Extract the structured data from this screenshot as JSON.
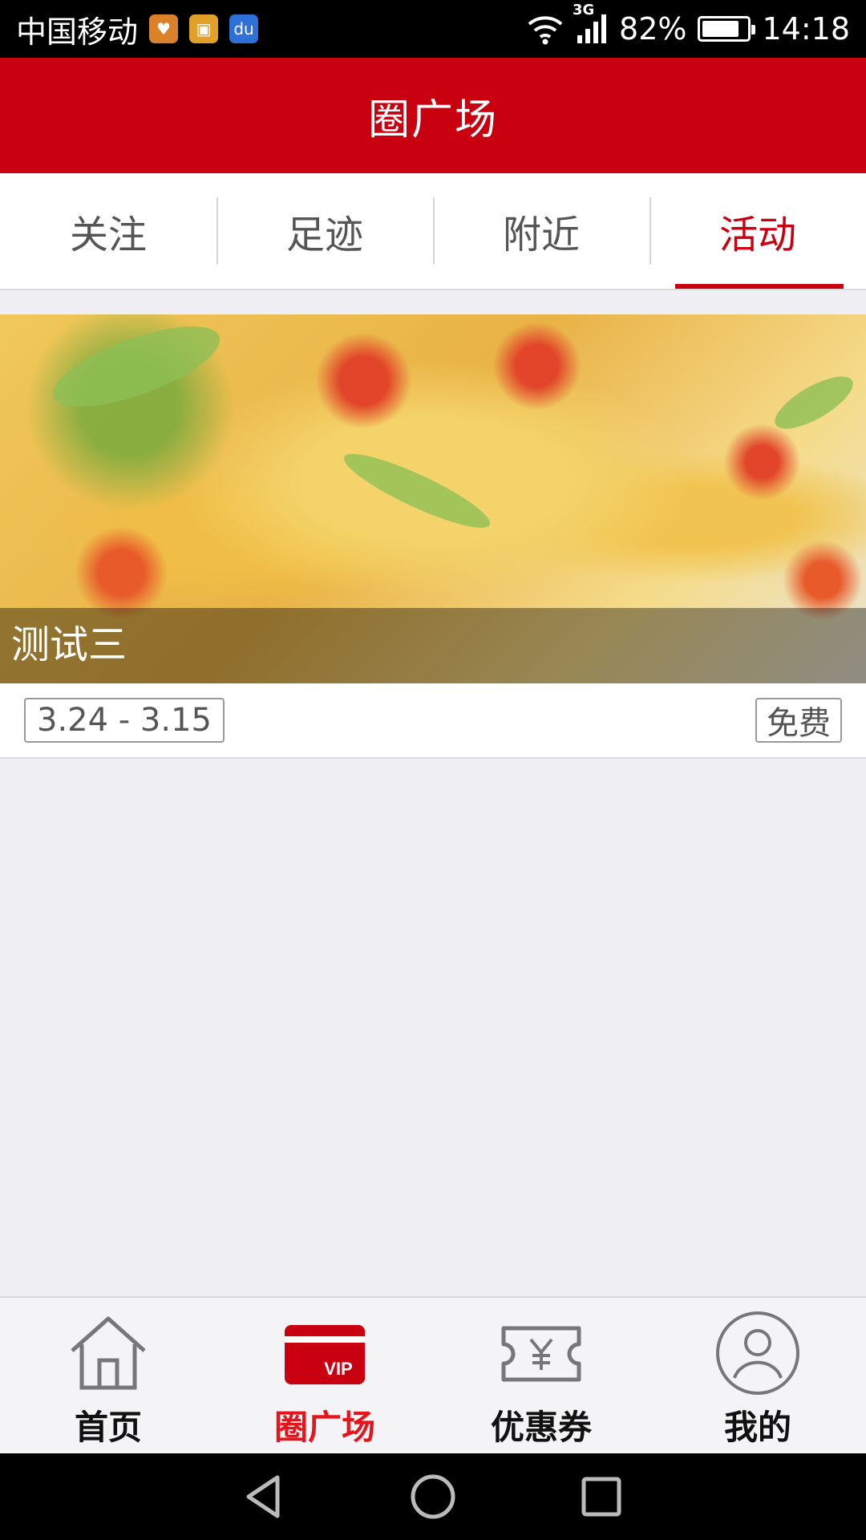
{
  "status_bar": {
    "carrier": "中国移动",
    "network": "3G",
    "battery": "82%",
    "battery_level": 0.82,
    "time": "14:18",
    "app_icons": [
      "health-app-icon",
      "shopping-app-icon",
      "baidu-app-icon"
    ]
  },
  "header": {
    "title": "圈广场"
  },
  "tabs": [
    {
      "label": "关注",
      "active": false
    },
    {
      "label": "足迹",
      "active": false
    },
    {
      "label": "附近",
      "active": false
    },
    {
      "label": "活动",
      "active": true
    }
  ],
  "activity": {
    "title": "测试三",
    "date_range": "3.24 - 3.15",
    "price": "免费"
  },
  "bottom_nav": [
    {
      "label": "首页",
      "icon": "home-icon",
      "active": false
    },
    {
      "label": "圈广场",
      "icon": "vip-card-icon",
      "active": true
    },
    {
      "label": "优惠券",
      "icon": "coupon-icon",
      "active": false
    },
    {
      "label": "我的",
      "icon": "profile-icon",
      "active": false
    }
  ],
  "system_nav": [
    "back-icon",
    "home-circle-icon",
    "recents-icon"
  ],
  "colors": {
    "brand_red": "#c8000f",
    "active_nav_red": "#e8141c",
    "background": "#efeff4"
  }
}
